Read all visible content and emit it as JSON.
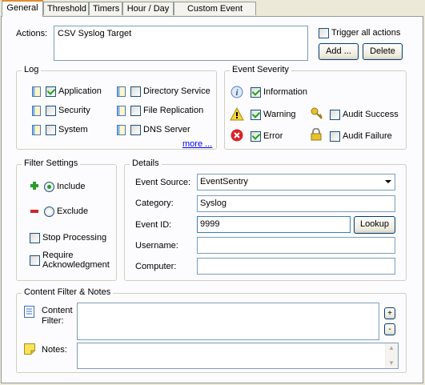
{
  "tabs": [
    "General",
    "Threshold",
    "Timers",
    "Hour / Day",
    "Custom Event Logs"
  ],
  "actions": {
    "label": "Actions:",
    "list": [
      "CSV Syslog Target"
    ],
    "trigger_all_label": "Trigger all actions",
    "trigger_all_checked": false,
    "add_label": "Add ...",
    "delete_label": "Delete"
  },
  "log": {
    "title": "Log",
    "items": [
      {
        "label": "Application",
        "checked": true
      },
      {
        "label": "Security",
        "checked": false
      },
      {
        "label": "System",
        "checked": false
      },
      {
        "label": "Directory Service",
        "checked": false
      },
      {
        "label": "File Replication",
        "checked": false
      },
      {
        "label": "DNS Server",
        "checked": false
      }
    ],
    "more_label": "more ..."
  },
  "severity": {
    "title": "Event Severity",
    "items": [
      {
        "label": "Information",
        "checked": true
      },
      {
        "label": "Warning",
        "checked": true
      },
      {
        "label": "Error",
        "checked": true
      },
      {
        "label": "Audit Success",
        "checked": false
      },
      {
        "label": "Audit Failure",
        "checked": false
      }
    ]
  },
  "filter": {
    "title": "Filter Settings",
    "include_label": "Include",
    "exclude_label": "Exclude",
    "mode": "include",
    "stop_processing_label": "Stop Processing",
    "require_ack_label_1": "Require",
    "require_ack_label_2": "Acknowledgment"
  },
  "details": {
    "title": "Details",
    "event_source_label": "Event Source:",
    "event_source_value": "EventSentry",
    "category_label": "Category:",
    "category_value": "Syslog",
    "event_id_label": "Event ID:",
    "event_id_value": "9999",
    "lookup_label": "Lookup",
    "username_label": "Username:",
    "username_value": "",
    "computer_label": "Computer:",
    "computer_value": ""
  },
  "content": {
    "title": "Content Filter & Notes",
    "content_label_1": "Content",
    "content_label_2": "Filter:",
    "content_value": "",
    "plus_label": "+",
    "minus_label": "-",
    "notes_label": "Notes:",
    "notes_value": ""
  }
}
